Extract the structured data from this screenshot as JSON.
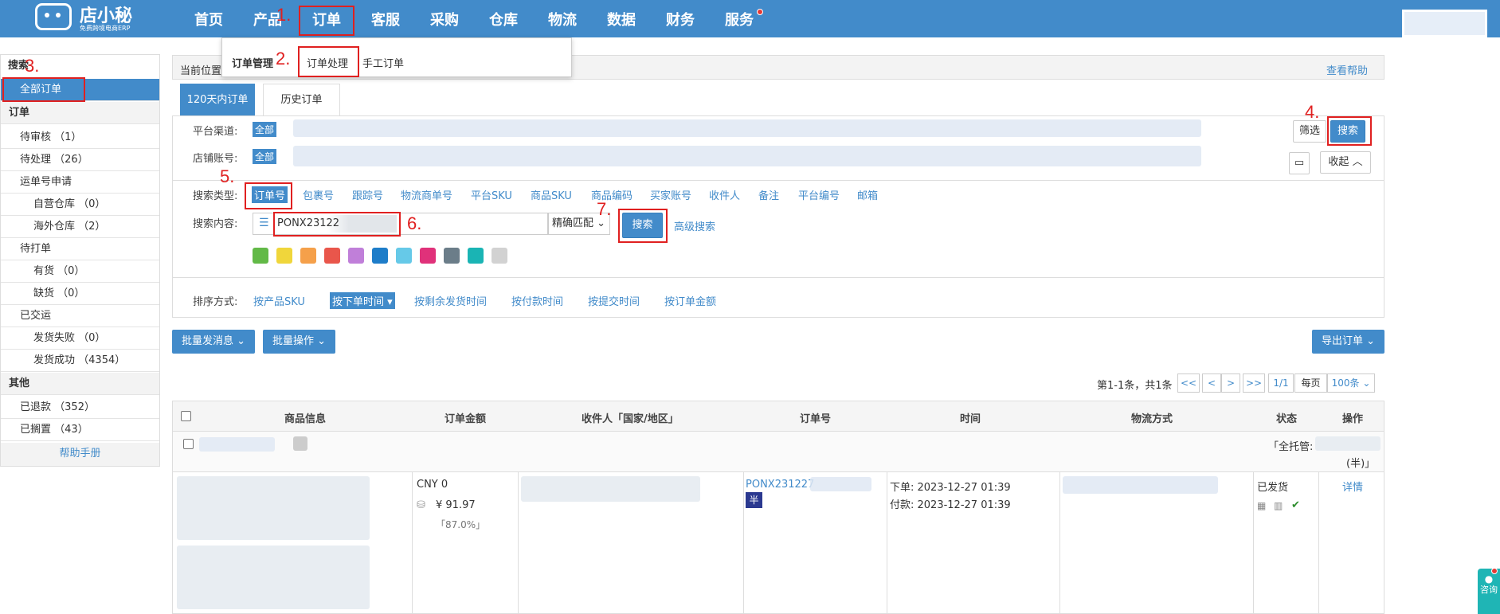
{
  "brand": {
    "name": "店小秘",
    "subtitle": "免费跨境电商ERP"
  },
  "nav": [
    "首页",
    "产品",
    "订单",
    "客服",
    "采购",
    "仓库",
    "物流",
    "数据",
    "财务",
    "服务"
  ],
  "annotations": [
    "1.",
    "2.",
    "3.",
    "4.",
    "5.",
    "6.",
    "7."
  ],
  "dropdown": {
    "group": "订单管理",
    "item_active": "订单处理",
    "item2": "手工订单"
  },
  "breadcrumb": {
    "label": "当前位置",
    "help": "查看帮助"
  },
  "sidebar": {
    "search_head": "搜索",
    "all_orders": "全部订单",
    "order_head": "订单",
    "items": [
      {
        "label": "待审核",
        "count": "（1）"
      },
      {
        "label": "待处理",
        "count": "（26）"
      },
      {
        "label": "运单号申请",
        "count": ""
      },
      {
        "label": "自营仓库",
        "count": "（0）"
      },
      {
        "label": "海外仓库",
        "count": "（2）"
      },
      {
        "label": "待打单",
        "count": ""
      },
      {
        "label": "有货",
        "count": "（0）"
      },
      {
        "label": "缺货",
        "count": "（0）"
      },
      {
        "label": "已交运",
        "count": ""
      },
      {
        "label": "发货失败",
        "count": "（0）"
      },
      {
        "label": "发货成功",
        "count": "（4354）"
      }
    ],
    "other_head": "其他",
    "other_items": [
      {
        "label": "已退款",
        "count": "（352）"
      },
      {
        "label": "已搁置",
        "count": "（43）"
      }
    ],
    "help": "帮助手册"
  },
  "tabs": [
    "120天内订单",
    "历史订单"
  ],
  "filters": {
    "channel_label": "平台渠道:",
    "channel_value": "全部",
    "store_label": "店铺账号:",
    "store_value": "全部",
    "screen_button": "筛选",
    "search_button": "搜索",
    "collapse_button": "收起",
    "search_type_label": "搜索类型:",
    "search_types": [
      "订单号",
      "包裹号",
      "跟踪号",
      "物流商单号",
      "平台SKU",
      "商品SKU",
      "商品编码",
      "买家账号",
      "收件人",
      "备注",
      "平台编号",
      "邮箱"
    ],
    "search_content_label": "搜索内容:",
    "search_value": "PONX23122",
    "match_mode": "精确匹配",
    "search_submit": "搜索",
    "advanced": "高级搜索",
    "sort_label": "排序方式:",
    "sort_options": [
      "按产品SKU",
      "按下单时间 ▾",
      "按剩余发货时间",
      "按付款时间",
      "按提交时间",
      "按订单金额"
    ],
    "swatch_colors": [
      "#62b947",
      "#f0d63b",
      "#f5a04a",
      "#e9564b",
      "#c07fd9",
      "#1e7dc9",
      "#66c9e8",
      "#e0317a",
      "#6b7d89",
      "#1ab4b4",
      "#d2d2d2"
    ]
  },
  "actions": {
    "batch_message": "批量发消息",
    "batch_ops": "批量操作",
    "export": "导出订单"
  },
  "pagination": {
    "summary": "第1-1条，共1条",
    "first": "<<",
    "prev": "<",
    "next": ">",
    "last": ">>",
    "page": "1/1",
    "per_page_label": "每页",
    "per_page": "100条"
  },
  "table": {
    "headers": [
      "商品信息",
      "订单金额",
      "收件人「国家/地区」",
      "订单号",
      "时间",
      "物流方式",
      "状态",
      "操作"
    ],
    "group_tag": "「全托管:",
    "group_tag_end": "(半)」",
    "row": {
      "amount": "CNY 0",
      "amount_cny": "¥ 91.97",
      "ratio": "「87.0%」",
      "order_no": "PONX231227",
      "half": "半",
      "order_time": "下单:  2023-12-27 01:39",
      "pay_time": "付款:  2023-12-27 01:39",
      "status": "已发货",
      "action": "详情"
    }
  },
  "consult": "咨询"
}
